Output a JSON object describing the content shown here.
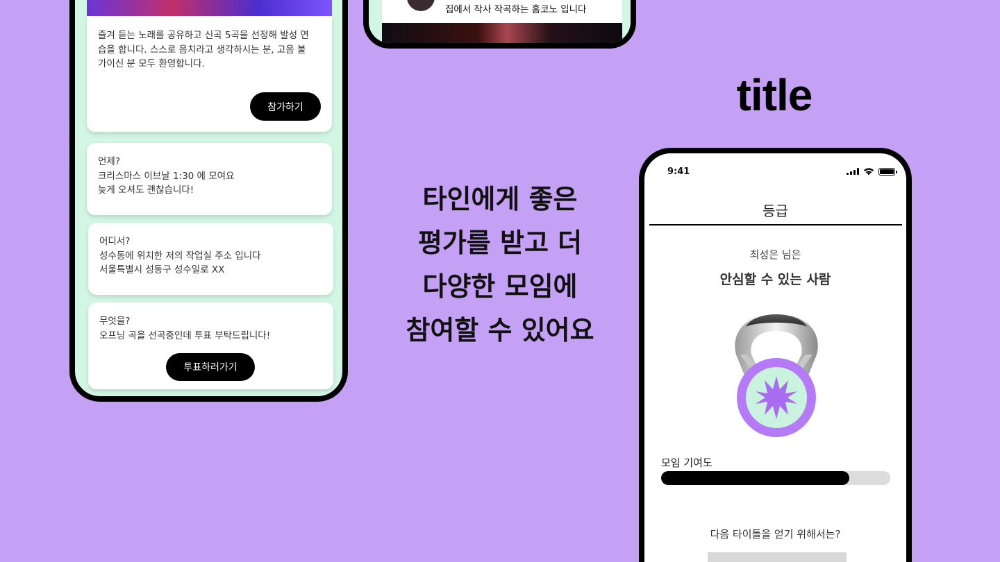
{
  "left_phone": {
    "intro_text": "즐겨 듣는 노래를 공유하고 신곡 5곡을 선정해 발성 연\n습을 합니다. 스스로 음치라고 생각하시는 분, 고음 불\n가이신 분 모두 환영합니다.",
    "join_button": "참가하기",
    "when": {
      "question": "언제?",
      "line1": "크리스마스 이브날 1:30 에 모여요",
      "line2": "늦게 오셔도 괜찮습니다!"
    },
    "where": {
      "question": "어디서?",
      "line1": "성수동에 위치한 저의 작업실 주소 입니다",
      "line2": "서울특별시 성동구 성수일로 XX"
    },
    "what": {
      "question": "무엇을?",
      "line1": "오프닝 곡을 선곡중인데  투표 부탁드립니다!"
    },
    "vote_button": "투표하러가기"
  },
  "top_phone": {
    "caption": "집에서 작사 작곡하는 홈코노 입니다"
  },
  "headline": {
    "line1": "타인에게 좋은",
    "line2": "평가를 받고 더",
    "line3": "다양한 모임에",
    "line4": "참여할 수 있어요"
  },
  "section_label": "title",
  "right_phone": {
    "status_time": "9:41",
    "nav_title": "등급",
    "user_line": "최성은 님은",
    "rank_title": "안심할 수 있는 사람",
    "contribution_label": "모임 기여도",
    "contribution_progress": 0.82,
    "next_title_question": "다음 타이틀을 얻기 위해서는?"
  },
  "colors": {
    "background": "#c4a1f4",
    "phone_background": "#d2f5e4",
    "medal_ring": "#b57af5",
    "medal_center": "#c9f2df",
    "medal_star": "#a86cf0"
  }
}
